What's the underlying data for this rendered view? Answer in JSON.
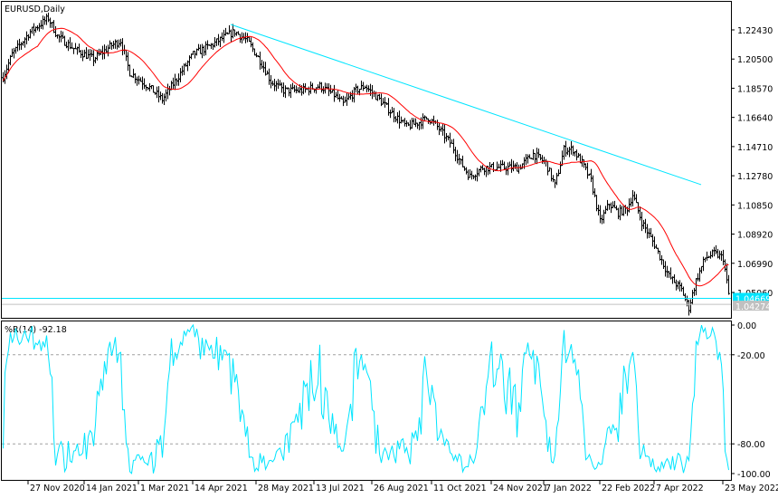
{
  "chart_data": {
    "type": "line",
    "title": "EURUSD,Daily",
    "colors": {
      "bars": "#000000",
      "ma": "#ff0000",
      "trendline": "#00e5ff",
      "bid_line": "#00e5ff",
      "ask_line": "#c0c0c0",
      "indicator": "#00e5ff",
      "level": "#a0a0a0"
    },
    "price_axis": {
      "ticks": [
        "1.22430",
        "1.20500",
        "1.18570",
        "1.16640",
        "1.14710",
        "1.12780",
        "1.10850",
        "1.08920",
        "1.06990",
        "1.05060"
      ],
      "ylim": [
        1.0375,
        1.244
      ]
    },
    "price_labels": {
      "bid": "1.04669",
      "ask": "1.04274"
    },
    "bar_count": 402,
    "close_keypoints": [
      [
        0,
        1.1932
      ],
      [
        5,
        1.2081
      ],
      [
        15,
        1.2231
      ],
      [
        25,
        1.2321
      ],
      [
        30,
        1.2201
      ],
      [
        40,
        1.2111
      ],
      [
        50,
        1.2051
      ],
      [
        60,
        1.2141
      ],
      [
        65,
        1.2171
      ],
      [
        70,
        1.1961
      ],
      [
        80,
        1.1872
      ],
      [
        88,
        1.1782
      ],
      [
        95,
        1.1902
      ],
      [
        105,
        1.2081
      ],
      [
        115,
        1.2141
      ],
      [
        123,
        1.2201
      ],
      [
        128,
        1.2231
      ],
      [
        135,
        1.2171
      ],
      [
        143,
        1.2021
      ],
      [
        148,
        1.1902
      ],
      [
        155,
        1.1842
      ],
      [
        165,
        1.1842
      ],
      [
        175,
        1.1872
      ],
      [
        183,
        1.1812
      ],
      [
        188,
        1.1752
      ],
      [
        195,
        1.1842
      ],
      [
        200,
        1.1872
      ],
      [
        208,
        1.1782
      ],
      [
        215,
        1.1692
      ],
      [
        223,
        1.1602
      ],
      [
        230,
        1.1632
      ],
      [
        235,
        1.1662
      ],
      [
        240,
        1.1602
      ],
      [
        248,
        1.1482
      ],
      [
        253,
        1.1362
      ],
      [
        258,
        1.1273
      ],
      [
        265,
        1.1332
      ],
      [
        275,
        1.1332
      ],
      [
        285,
        1.1332
      ],
      [
        293,
        1.1422
      ],
      [
        300,
        1.1362
      ],
      [
        305,
        1.1213
      ],
      [
        310,
        1.1452
      ],
      [
        315,
        1.1452
      ],
      [
        320,
        1.1362
      ],
      [
        325,
        1.1243
      ],
      [
        330,
        1.0973
      ],
      [
        335,
        1.1093
      ],
      [
        340,
        1.1033
      ],
      [
        345,
        1.1063
      ],
      [
        348,
        1.1153
      ],
      [
        353,
        1.0973
      ],
      [
        360,
        1.0823
      ],
      [
        368,
        1.0614
      ],
      [
        375,
        1.0524
      ],
      [
        379,
        1.0404
      ],
      [
        383,
        1.0584
      ],
      [
        388,
        1.0734
      ],
      [
        393,
        1.0764
      ],
      [
        398,
        1.0734
      ],
      [
        401,
        1.0494
      ]
    ],
    "ma_period": 20,
    "trendline": {
      "from": [
        126,
        1.2279
      ],
      "to": [
        386,
        1.1219
      ]
    },
    "x_axis": {
      "ticks": [
        [
          14,
          "27 Nov 2020"
        ],
        [
          45,
          "14 Jan 2021"
        ],
        [
          75,
          "1 Mar 2021"
        ],
        [
          105,
          "14 Apr 2021"
        ],
        [
          140,
          "28 May 2021"
        ],
        [
          172,
          "13 Jul 2021"
        ],
        [
          204,
          "26 Aug 2021"
        ],
        [
          237,
          "11 Oct 2021"
        ],
        [
          270,
          "24 Nov 2021"
        ],
        [
          299,
          "7 Jan 2022"
        ],
        [
          330,
          "22 Feb 2022"
        ],
        [
          360,
          "7 Apr 2022"
        ],
        [
          398,
          "23 May 2022"
        ]
      ]
    },
    "indicator": {
      "label": "%R(14) -92.18",
      "period": 14,
      "ylim": [
        -100,
        0
      ],
      "ticks": [
        "0.00",
        "-20.00",
        "-80.00",
        "-100.00"
      ],
      "levels": [
        -20,
        -80
      ]
    }
  }
}
